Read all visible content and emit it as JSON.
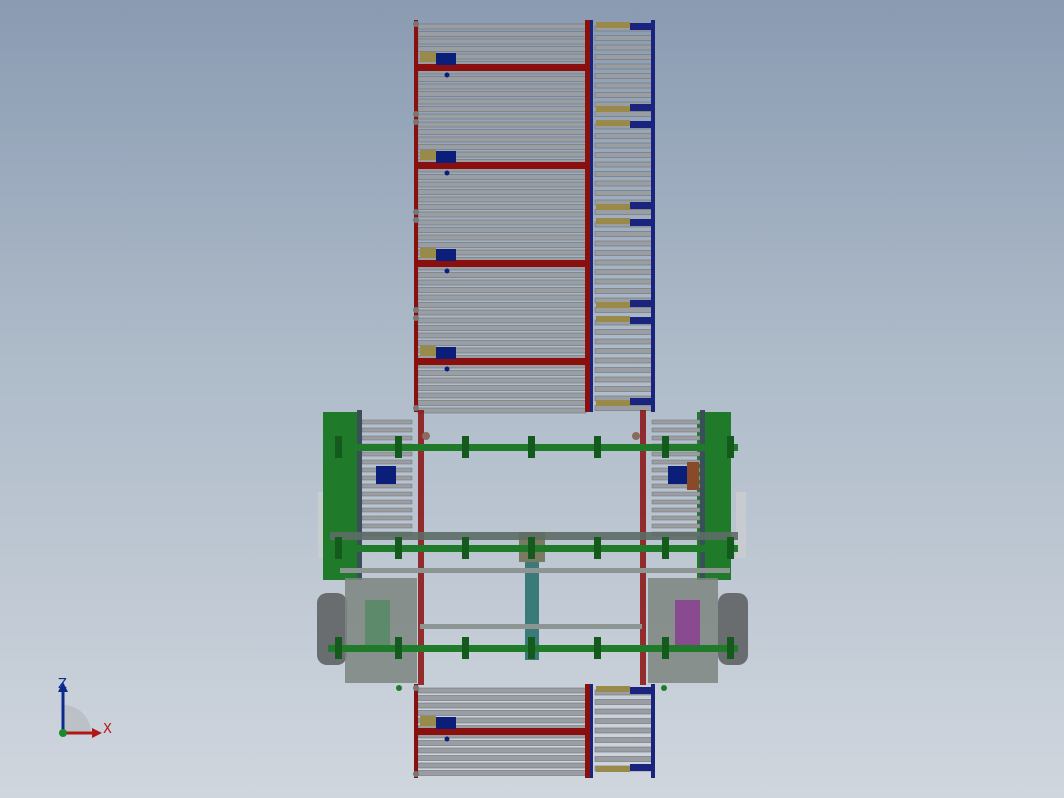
{
  "viewport": {
    "background_top": "#8a9bb2",
    "background_bottom": "#d0d6de"
  },
  "model": {
    "colors": {
      "roller": "#9a9ea3",
      "roller_dark": "#6e7378",
      "frame_red": "#8a0f0f",
      "frame_blue": "#1a237e",
      "bracket_tan": "#9a8a4a",
      "motor_blue": "#0b1f7a",
      "frame_green": "#1f7a2a",
      "green_dark": "#145a1c",
      "wheel": "#6a6d70",
      "chain": "#5d6b66",
      "teal": "#3a7a78",
      "purple": "#8a4a8f"
    },
    "conveyor_module_count_upper": 4,
    "conveyor_module_count_lower": 1
  },
  "triad": {
    "z_label": "Z",
    "x_label": "X",
    "z_color": "#0b2a8c",
    "x_color": "#b01818",
    "origin_color": "#1a8a2a"
  }
}
